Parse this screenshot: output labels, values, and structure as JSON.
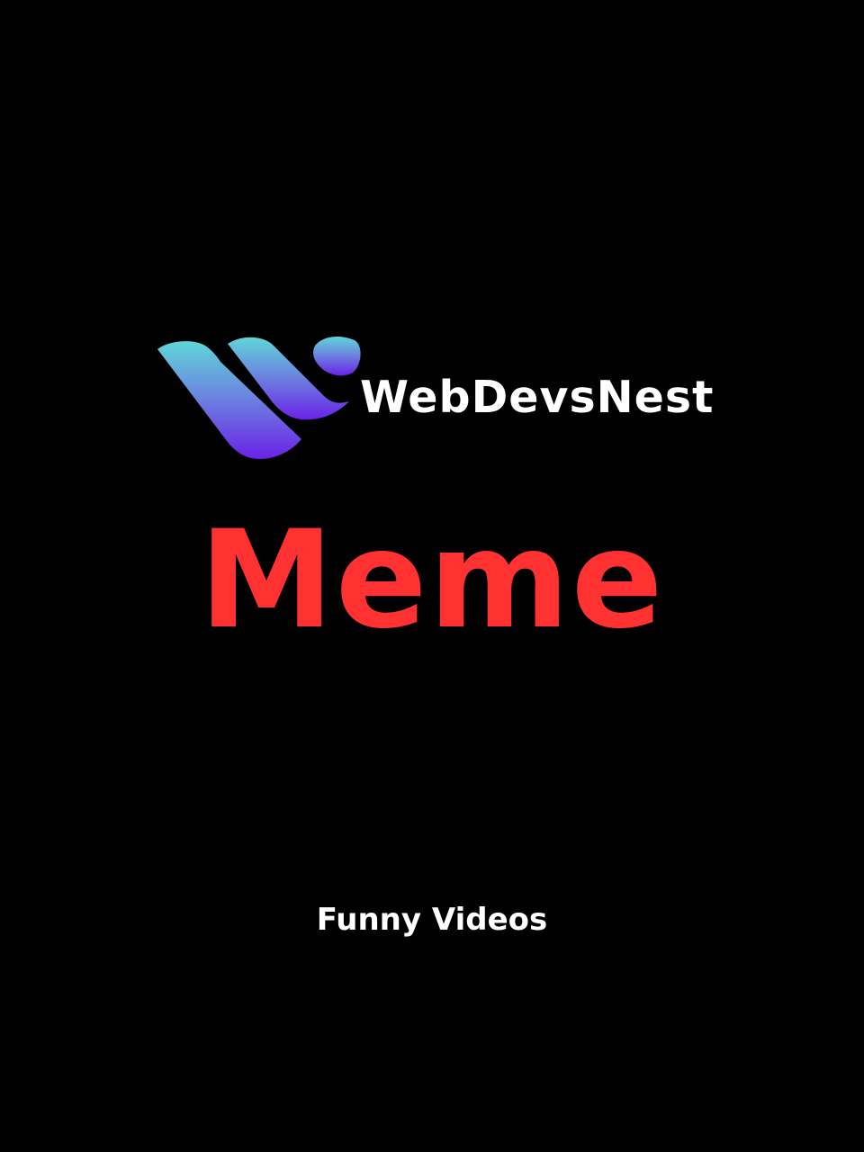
{
  "logo": {
    "icon": "webdevsnest-w-logo-icon",
    "brand_name": "WebDevsNest",
    "gradient_top": "#5fd6d8",
    "gradient_bottom": "#6a22e6"
  },
  "headline": "Meme",
  "subtitle": "Funny Videos",
  "colors": {
    "background": "#000000",
    "headline": "#ff3131",
    "text": "#ffffff"
  }
}
